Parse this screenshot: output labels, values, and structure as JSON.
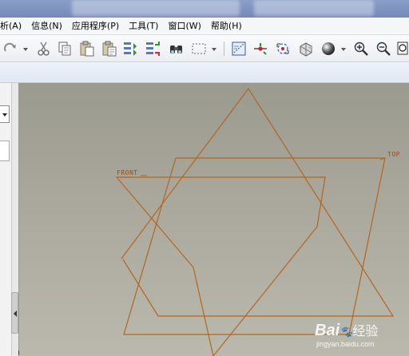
{
  "menubar": {
    "items": [
      {
        "label": "析(A)"
      },
      {
        "label": "信息(N)"
      },
      {
        "label": "应用程序(P)"
      },
      {
        "label": "工具(T)"
      },
      {
        "label": "窗口(W)"
      },
      {
        "label": "帮助(H)"
      }
    ]
  },
  "toolbar": {
    "icons": [
      "redo-icon",
      "cut-icon",
      "copy-icon",
      "paste-icon",
      "paste-special-icon",
      "regenerate-icon",
      "regenerate-manager-icon",
      "find-icon",
      "select-box-icon",
      "view-manager-icon",
      "datum-display-icon",
      "spin-center-icon",
      "model-display-icon",
      "shading-icon",
      "zoom-in-icon",
      "zoom-out-icon",
      "refit-icon"
    ]
  },
  "graphics": {
    "planes": {
      "front": "FRONT",
      "top": "TOP"
    },
    "colors": {
      "datum": "#b5651d",
      "background_top": "#9a9a8e",
      "background_bottom": "#bab9ad"
    }
  },
  "watermark": {
    "brand": "Bai",
    "brand2": "经验",
    "url": "jingyan.baidu.com"
  }
}
